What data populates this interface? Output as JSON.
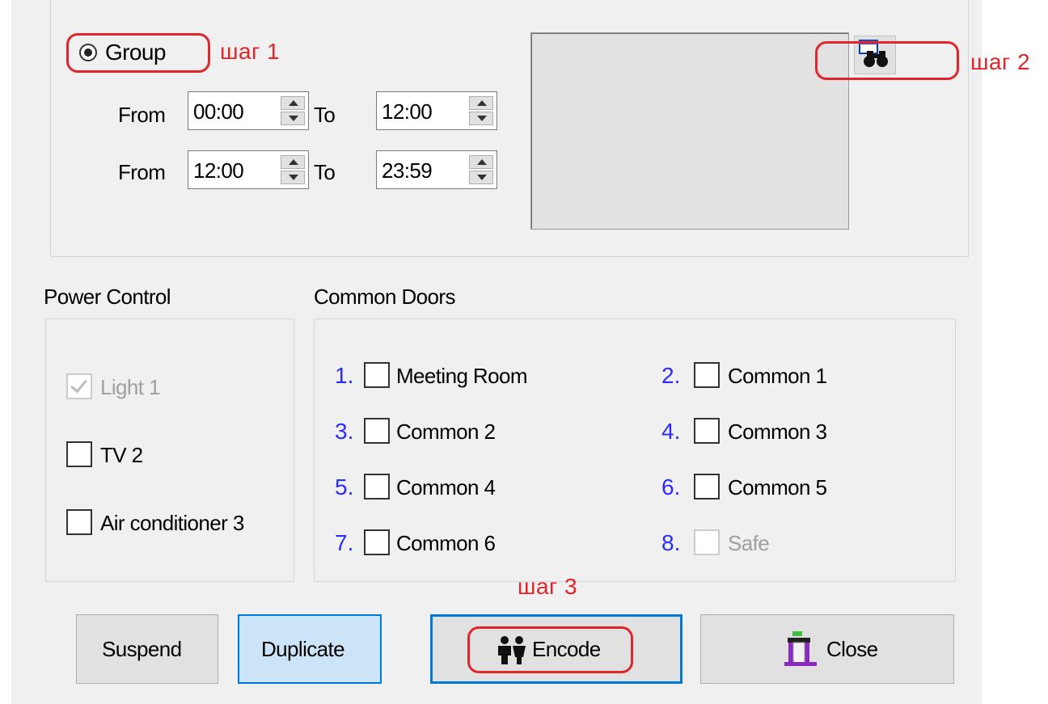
{
  "schedule": {
    "group_label": "Group",
    "rows": [
      {
        "from_label": "From",
        "from_value": "00:00",
        "to_label": "To",
        "to_value": "12:00"
      },
      {
        "from_label": "From",
        "from_value": "12:00",
        "to_label": "To",
        "to_value": "23:59"
      }
    ]
  },
  "power_control": {
    "title": "Power Control",
    "items": [
      {
        "label": "Light 1",
        "checked": true,
        "disabled": true
      },
      {
        "label": "TV 2",
        "checked": false,
        "disabled": false
      },
      {
        "label": "Air conditioner 3",
        "checked": false,
        "disabled": false
      }
    ]
  },
  "common_doors": {
    "title": "Common Doors",
    "items": [
      {
        "num": "1.",
        "label": "Meeting Room"
      },
      {
        "num": "2.",
        "label": "Common 1"
      },
      {
        "num": "3.",
        "label": "Common 2"
      },
      {
        "num": "4.",
        "label": "Common 3"
      },
      {
        "num": "5.",
        "label": "Common 4"
      },
      {
        "num": "6.",
        "label": "Common 5"
      },
      {
        "num": "7.",
        "label": "Common 6"
      },
      {
        "num": "8.",
        "label": "Safe",
        "disabled": true
      }
    ]
  },
  "buttons": {
    "suspend": "Suspend",
    "duplicate": "Duplicate",
    "encode": "Encode",
    "close": "Close"
  },
  "annotations": {
    "step1": "шаг 1",
    "step2": "шаг 2",
    "step3": "шаг 3"
  },
  "colors": {
    "annotation": "#e0262c",
    "door_number": "#2b2bff",
    "focus_border": "#0078d7",
    "duplicate_bg": "#cce4f7"
  }
}
